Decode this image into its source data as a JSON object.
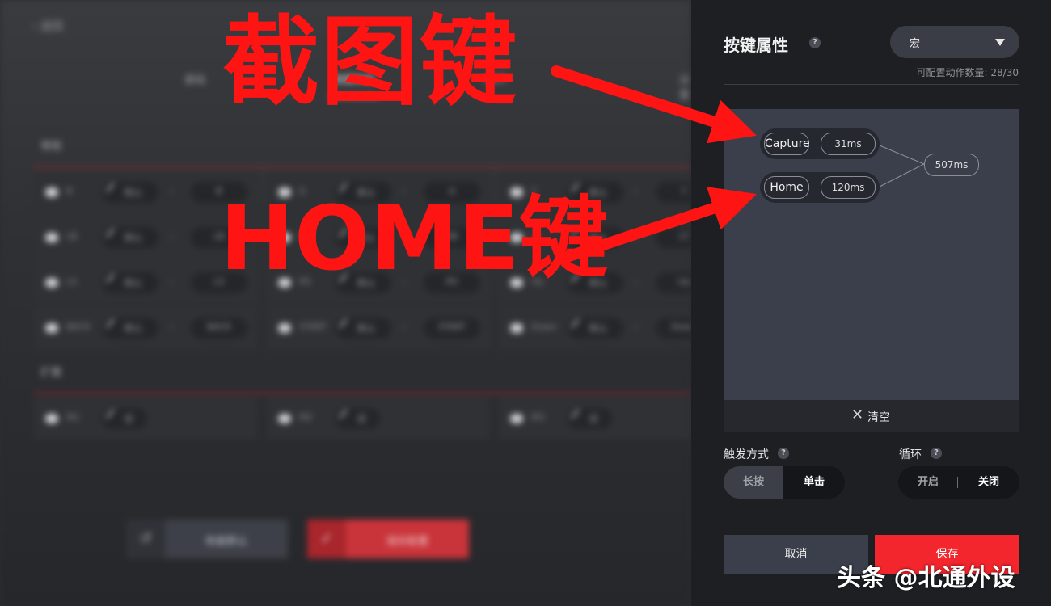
{
  "background": {
    "back_label": "返回",
    "tabs": [
      "基础",
      "按键映射",
      "摇杆",
      "设置"
    ],
    "section_regular": "常规",
    "section_extended": "扩展",
    "rows": [
      [
        {
          "name": "B",
          "mode": "默认",
          "key": "B"
        },
        {
          "name": "A",
          "mode": "默认",
          "key": "A"
        },
        {
          "name": "Y",
          "mode": "默认",
          "key": "Y"
        }
      ],
      [
        {
          "name": "LB",
          "mode": "默认",
          "key": "LB"
        },
        {
          "name": "RB",
          "mode": "默认",
          "key": "RB"
        },
        {
          "name": "LT",
          "mode": "默认",
          "key": "LT"
        }
      ],
      [
        {
          "name": "LS",
          "mode": "默认",
          "key": "LS"
        },
        {
          "name": "RS",
          "mode": "默认",
          "key": "RS"
        },
        {
          "name": "Up",
          "mode": "默认",
          "key": "Up"
        }
      ],
      [
        {
          "name": "BACK",
          "mode": "默认",
          "key": "BACK"
        },
        {
          "name": "START",
          "mode": "默认",
          "key": "START"
        },
        {
          "name": "Down",
          "mode": "默认",
          "key": "Down"
        }
      ]
    ],
    "ext_rows": [
      {
        "name": "M1",
        "mode": "宏"
      },
      {
        "name": "M2",
        "mode": "宏"
      },
      {
        "name": "M3",
        "mode": "宏"
      }
    ],
    "reset_label": "恢复默认",
    "save_config_label": "保存配置"
  },
  "panel": {
    "title": "按键属性",
    "help": "?",
    "select_value": "宏",
    "action_count": "可配置动作数量: 28/30",
    "macro": {
      "steps": [
        {
          "key": "Capture",
          "duration": "31ms"
        },
        {
          "key": "Home",
          "duration": "120ms"
        }
      ],
      "total": "507ms"
    },
    "clear_icon": "✕",
    "clear_label": "清空",
    "trigger_label": "触发方式",
    "trigger_options": [
      "长按",
      "单击"
    ],
    "trigger_selected": "单击",
    "loop_label": "循环",
    "loop_options": [
      "开启",
      "关闭"
    ],
    "loop_selected": "关闭",
    "cancel_label": "取消",
    "save_label": "保存"
  },
  "annotations": {
    "screenshot_key": "截图键",
    "home_key": "HOME键",
    "color": "#ff1414"
  },
  "watermark": "头条 @北通外设"
}
